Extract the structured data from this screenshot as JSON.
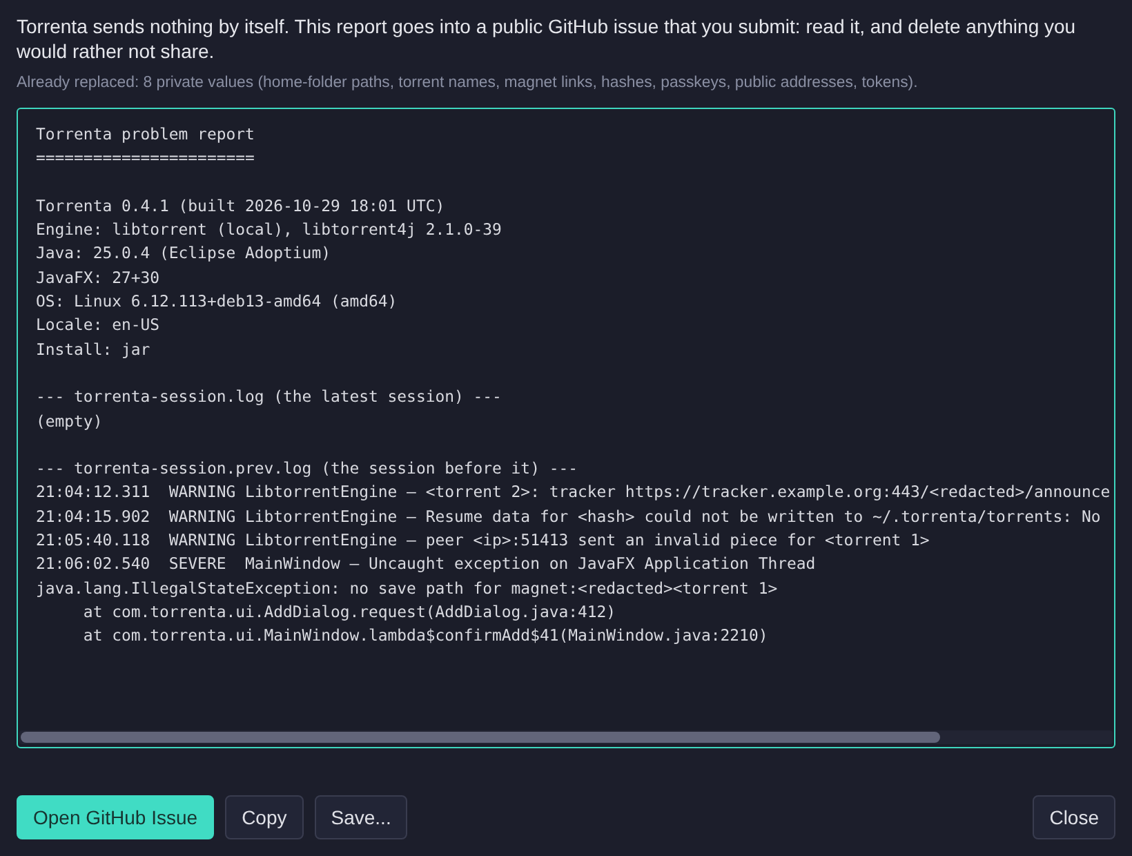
{
  "intro": "Torrenta sends nothing by itself. This report goes into a public GitHub issue that you submit: read it, and delete anything you would rather not share.",
  "note": "Already replaced: 8 private values (home-folder paths, torrent names, magnet links, hashes, passkeys, public addresses, tokens).",
  "report": {
    "sections": [
      {
        "lines": [
          "Torrenta problem report",
          "======================="
        ]
      },
      {
        "lines": [
          "Torrenta 0.4.1 (built 2026-10-29 18:01 UTC)",
          "Engine: libtorrent (local), libtorrent4j 2.1.0-39",
          "Java: 25.0.4 (Eclipse Adoptium)",
          "JavaFX: 27+30",
          "OS: Linux 6.12.113+deb13-amd64 (amd64)",
          "Locale: en-US",
          "Install: jar"
        ]
      },
      {
        "lines": [
          "--- torrenta-session.log (the latest session) ---",
          "(empty)"
        ]
      },
      {
        "lines": [
          "--- torrenta-session.prev.log (the session before it) ---",
          "21:04:12.311  WARNING LibtorrentEngine — <torrent 2>: tracker https://tracker.example.org:443/<redacted>/announce",
          "21:04:15.902  WARNING LibtorrentEngine — Resume data for <hash> could not be written to ~/.torrenta/torrents: No",
          "21:05:40.118  WARNING LibtorrentEngine — peer <ip>:51413 sent an invalid piece for <torrent 1>",
          "21:06:02.540  SEVERE  MainWindow — Uncaught exception on JavaFX Application Thread",
          "java.lang.IllegalStateException: no save path for magnet:<redacted><torrent 1>",
          "     at com.torrenta.ui.AddDialog.request(AddDialog.java:412)",
          "     at com.torrenta.ui.MainWindow.lambda$confirmAdd$41(MainWindow.java:2210)"
        ]
      }
    ]
  },
  "actions": [
    {
      "label": "Open GitHub Issue",
      "kind": "primary"
    },
    {
      "label": "Copy",
      "kind": "secondary"
    },
    {
      "label": "Save...",
      "kind": "secondary"
    }
  ],
  "close": {
    "label": "Close",
    "kind": "secondary"
  }
}
